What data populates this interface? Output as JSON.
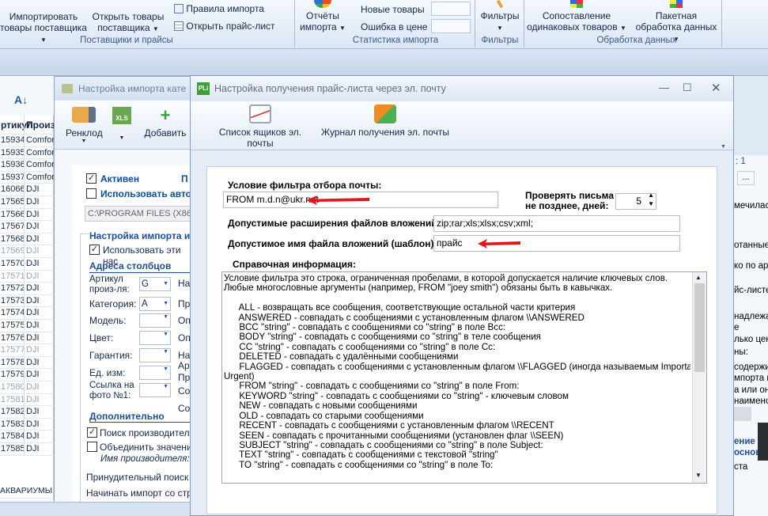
{
  "ribbon": {
    "import_supplier_label_1": "Импортировать",
    "import_supplier_label_2": "товары поставщика",
    "open_supplier_label_1": "Открыть товары",
    "open_supplier_label_2": "поставщика",
    "import_rules": "Правила импорта",
    "open_pricelist": "Открыть прайс-лист",
    "group_suppliers": "Поставщики и прайсы",
    "reports_label_1": "Отчёты",
    "reports_label_2": "импорта",
    "new_goods": "Новые товары",
    "price_error": "Ошибка в цене",
    "group_stats": "Статистика импорта",
    "filters": "Фильтры",
    "group_filters": "Фильтры",
    "compare_label_1": "Сопоставление",
    "compare_label_2": "одинаковых товаров",
    "batch_label_1": "Пакетная",
    "batch_label_2": "обработка данных",
    "group_processing": "Обработка данных"
  },
  "left_table": {
    "header_a": "ртикул",
    "header_b": "Произ",
    "rows": [
      {
        "a": "15934",
        "b": "Comfor",
        "dim": false
      },
      {
        "a": "15935",
        "b": "Comfor",
        "dim": false
      },
      {
        "a": "15936",
        "b": "Comfor",
        "dim": false
      },
      {
        "a": "15937",
        "b": "Comfor",
        "dim": false
      },
      {
        "a": "16066",
        "b": "DJI",
        "dim": false
      },
      {
        "a": "17565",
        "b": "DJI",
        "dim": false
      },
      {
        "a": "17566",
        "b": "DJI",
        "dim": false
      },
      {
        "a": "17567",
        "b": "DJI",
        "dim": false
      },
      {
        "a": "17568",
        "b": "DJI",
        "dim": false
      },
      {
        "a": "17569",
        "b": "DJI",
        "dim": true
      },
      {
        "a": "17570",
        "b": "DJI",
        "dim": false
      },
      {
        "a": "17571",
        "b": "DJI",
        "dim": true
      },
      {
        "a": "17572",
        "b": "DJI",
        "dim": false
      },
      {
        "a": "17573",
        "b": "DJI",
        "dim": false
      },
      {
        "a": "17574",
        "b": "DJI",
        "dim": false
      },
      {
        "a": "17575",
        "b": "DJI",
        "dim": false
      },
      {
        "a": "17576",
        "b": "DJI",
        "dim": false
      },
      {
        "a": "17577",
        "b": "DJI",
        "dim": true
      },
      {
        "a": "17578",
        "b": "DJI",
        "dim": false
      },
      {
        "a": "17579",
        "b": "DJI",
        "dim": false
      },
      {
        "a": "17580",
        "b": "DJI",
        "dim": true
      },
      {
        "a": "17581",
        "b": "DJI",
        "dim": true
      },
      {
        "a": "17582",
        "b": "DJI",
        "dim": false
      },
      {
        "a": "17583",
        "b": "DJI",
        "dim": false
      },
      {
        "a": "17584",
        "b": "DJI",
        "dim": false
      },
      {
        "a": "17585",
        "b": "DJI",
        "dim": false
      }
    ],
    "footer": "АКВАРИУМЫ И А"
  },
  "import_window": {
    "title": "Настройка импорта кате",
    "tool_renklod": "Ренклод",
    "tool_add": "Добавить",
    "active": "Активен",
    "active_right": "П",
    "use_auto": "Использовать авто",
    "path": "C:\\PROGRAM FILES (X86)\\",
    "import_settings": "Настройка импорта из",
    "use_these": "Использовать эти нас",
    "columns_header": "Адреса столбцов",
    "art_label": "Артикул произ-ля:",
    "art_value": "G",
    "art_right": "На",
    "cat_label": "Категория:",
    "cat_value": "A",
    "cat_right": "Пр",
    "model_label": "Модель:",
    "model_right": "Оп",
    "color_label": "Цвет:",
    "color_right": "Оп",
    "warranty_label": "Гарантия:",
    "warranty_right": "На",
    "unit_label": "Ед. изм:",
    "unit_right_1": "Ар",
    "unit_right_2": "Пр",
    "photo_label": "Ссылка на фото №1:",
    "photo_right": "Со",
    "extra_right": "Со",
    "additional": "Дополнительно",
    "search_maker": "Поиск производителя",
    "merge_values": "Объединить значение",
    "maker_name": "Имя производителя:",
    "forced_search": "Принудительный поиск п",
    "start_import": "Начинать импорт со строк"
  },
  "dialog": {
    "title": "Настройка получения прайс-листа через эл. почту",
    "mailbox_list": "Список ящиков эл. почты",
    "receive_log": "Журнал получения эл. почты",
    "filter_label": "Условие фильтра отбора почты:",
    "filter_value": "FROM m.d.n@ukr.net",
    "check_label_1": "Проверять письма",
    "check_label_2": "не позднее, дней:",
    "days_value": "5",
    "ext_label": "Допустимые расширения файлов вложений:",
    "ext_value": "zip;rar;xls;xlsx;csv;xml;",
    "name_label": "Допустимое имя файла вложений (шаблон):",
    "name_value": "прайс",
    "help_label": "Справочная информация:",
    "help_lines": [
      "Условие фильтра это строка, ограниченная пробелами, в которой допускается наличие ключевых слов.",
      "Любые многословные аргументы (например, FROM \"joey smith\") обязаны быть в кавычках.",
      "",
      "      ALL - возвращать все сообщения, соответствующие остальной части критерия",
      "      ANSWERED - совпадать с сообщениями с установленным флагом \\\\ANSWERED",
      "      BCC \"string\" - совпадать с сообщениями со \"string\" в поле Bcc:",
      "      BODY \"string\" - совпадать с сообщениями со \"string\" в теле сообщения",
      "      CC \"string\" - совпадать с сообщениями со \"string\" в поле Cc:",
      "      DELETED - совпадать с удалёнными сообщениями",
      "      FLAGGED - совпадать с сообщениями с установленным флагом \\\\FLAGGED (иногда называемым Important или",
      "Urgent)",
      "      FROM \"string\" - совпадать с сообщениями со \"string\" в поле From:",
      "      KEYWORD \"string\" - совпадать с сообщениями со \"string\" - ключевым словом",
      "      NEW - совпадать с новыми сообщениями",
      "      OLD - совпадать со старыми сообщениями",
      "      RECENT - совпадать с сообщениями с установленным флагом \\\\RECENT",
      "      SEEN - совпадать с прочитанными сообщениями (установлен флаг \\\\SEEN)",
      "      SUBJECT \"string\" - совпадать с сообщениями со \"string\" в поле Subject:",
      "      TEXT \"string\" - совпадать с сообщениями с текстовой \"string\"",
      "      TO \"string\" - совпадать с сообщениями со \"string\" в поле To:"
    ]
  },
  "right_window": {
    "page": ": 1",
    "ellipsis": "...",
    "texts": [
      "мечилась",
      "отанные",
      "ко по арт",
      "йс-листе",
      "надлежа",
      "е",
      "лько цен",
      "ны:",
      "содержи",
      "мпорта и",
      "а или он",
      "наимено"
    ],
    "bold_1": "ение",
    "bold_2": "основа",
    "last": "ста"
  },
  "colors": {
    "arrow_red": "#e0181e",
    "accent_blue": "#0b4ea2",
    "section_blue": "#1f4e96"
  }
}
